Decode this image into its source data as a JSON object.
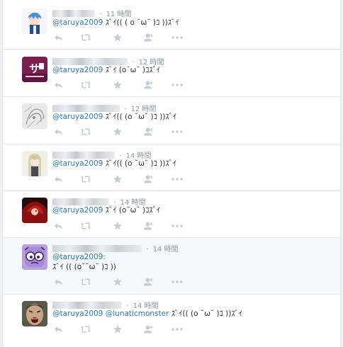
{
  "colors": {
    "background": "#eef0f2",
    "card": "#ffffff",
    "highlight_card": "#f5f8fa",
    "border": "#e1e8ed",
    "mention": "#2b7bb9",
    "text": "#292f33",
    "meta": "#8899a6",
    "action_icon": "#c6ced5"
  },
  "tweets": [
    {
      "time": "11 時間",
      "mention": "@taruya2009",
      "text": " ｽﾞｲ(( ( o ˘ω˘ )ｺ ))ｽﾞｲ",
      "avatar_icon": "anime-boy-avatar-icon"
    },
    {
      "time": "12 時間",
      "mention": "@taruya2009",
      "text": " ｽﾞｲ (o˘ω˘ )ｺｽﾞｲ",
      "avatar_icon": "purple-logo-avatar-icon",
      "avatar_text": "サ"
    },
    {
      "time": "12 時間",
      "mention": "@taruya2009",
      "text": " ｽﾞｲ(( (o ˘ω˘ )ｺ ))ｽﾞｲ",
      "avatar_icon": "sketch-avatar-icon"
    },
    {
      "time": "14 時間",
      "mention": "@taruya2009",
      "text": " ｽﾞｲ(( (o ˘ω˘ )ｺ ))ｽﾞｲ",
      "avatar_icon": "anime-girl-avatar-icon"
    },
    {
      "time": "14 時間",
      "mention": "@taruya2009",
      "text": " ｽﾞｲ (o˘ω˘ )ｺｽﾞｲ",
      "avatar_icon": "red-character-avatar-icon"
    },
    {
      "time": "14 時間",
      "mention": "@taruya2009:",
      "line2": "ｽﾞｲ (( (o˘˘ω˘ )ｺ ))",
      "avatar_icon": "purple-monster-avatar-icon"
    },
    {
      "time": "14 時間",
      "mention": "@taruya2009",
      "mention2": "@lunaticmonster",
      "text": " ｽﾞｲ(( (o ˘ω˘ )ｺ ))ｽﾞｲ",
      "avatar_icon": "screaming-man-avatar-icon"
    }
  ]
}
